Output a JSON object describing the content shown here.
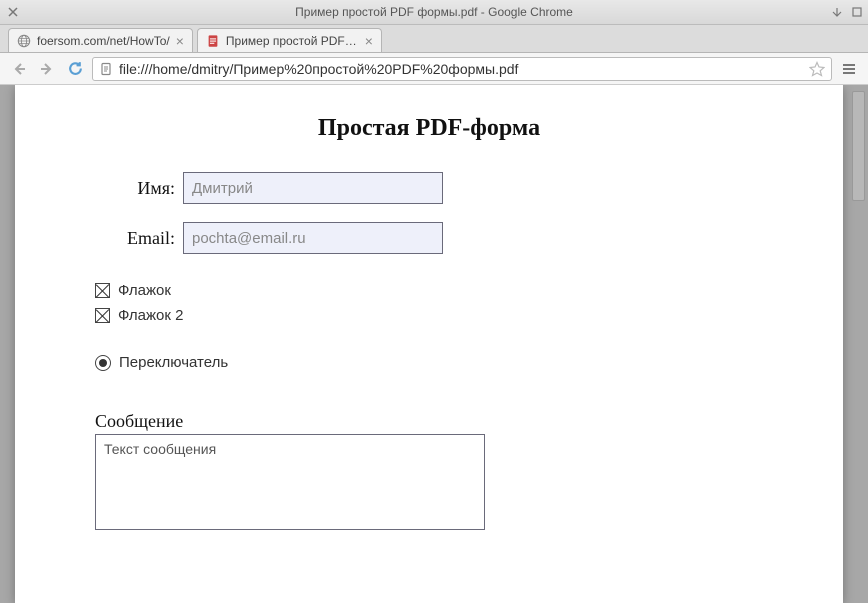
{
  "window": {
    "title": "Пример простой PDF формы.pdf - Google Chrome"
  },
  "tabs": [
    {
      "title": "foersom.com/net/HowTo/",
      "favicon": "globe"
    },
    {
      "title": "Пример простой PDF фо",
      "favicon": "pdf"
    }
  ],
  "url": "file:///home/dmitry/Пример%20простой%20PDF%20формы.pdf",
  "form": {
    "title": "Простая PDF-форма",
    "name_label": "Имя:",
    "name_value": "Дмитрий",
    "email_label": "Email:",
    "email_value": "pochta@email.ru",
    "check1_label": "Флажок",
    "check1_checked": true,
    "check2_label": "Флажок 2",
    "check2_checked": true,
    "radio1_label": "Переключатель",
    "radio1_selected": true,
    "message_label": "Сообщение",
    "message_value": "Текст сообщения"
  }
}
